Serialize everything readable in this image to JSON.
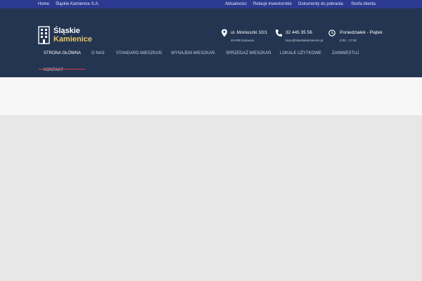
{
  "topbar": {
    "left_links": [
      "Home",
      "Śląskie Kamienice S.A."
    ],
    "right_links": [
      "Aktualności",
      "Relacje inwestorskie",
      "Dokumenty do pobrania",
      "Strefa klienta"
    ]
  },
  "logo": {
    "line1": "Śląskie",
    "line2": "Kamienice"
  },
  "info": [
    {
      "icon": "map-pin-icon",
      "main": "ul. Moniuszki 10/1",
      "sub": "40-005 Katowice"
    },
    {
      "icon": "phone-icon",
      "main": "32 445 35 56",
      "sub": "biuro@slaskiekamienice.pl"
    },
    {
      "icon": "clock-icon",
      "main": "Poniedziałek - Piątek",
      "sub": "8:00 - 17:00"
    }
  ],
  "nav": {
    "items": [
      "STRONA GŁÓWNA",
      "O NAS",
      "STANDARD MIESZKAŃ",
      "WYNAJEM MIESZKAŃ",
      "SPRZEDAŻ MIESZKAŃ",
      "LOKALE UŻYTKOWE",
      "ZAINWESTUJ",
      "KONTAKT"
    ],
    "active": "STRONA GŁÓWNA"
  },
  "colors": {
    "topbar": "#2c3990",
    "header": "#233551",
    "accent_gold": "#e8c462",
    "active_underline": "#d04545"
  }
}
